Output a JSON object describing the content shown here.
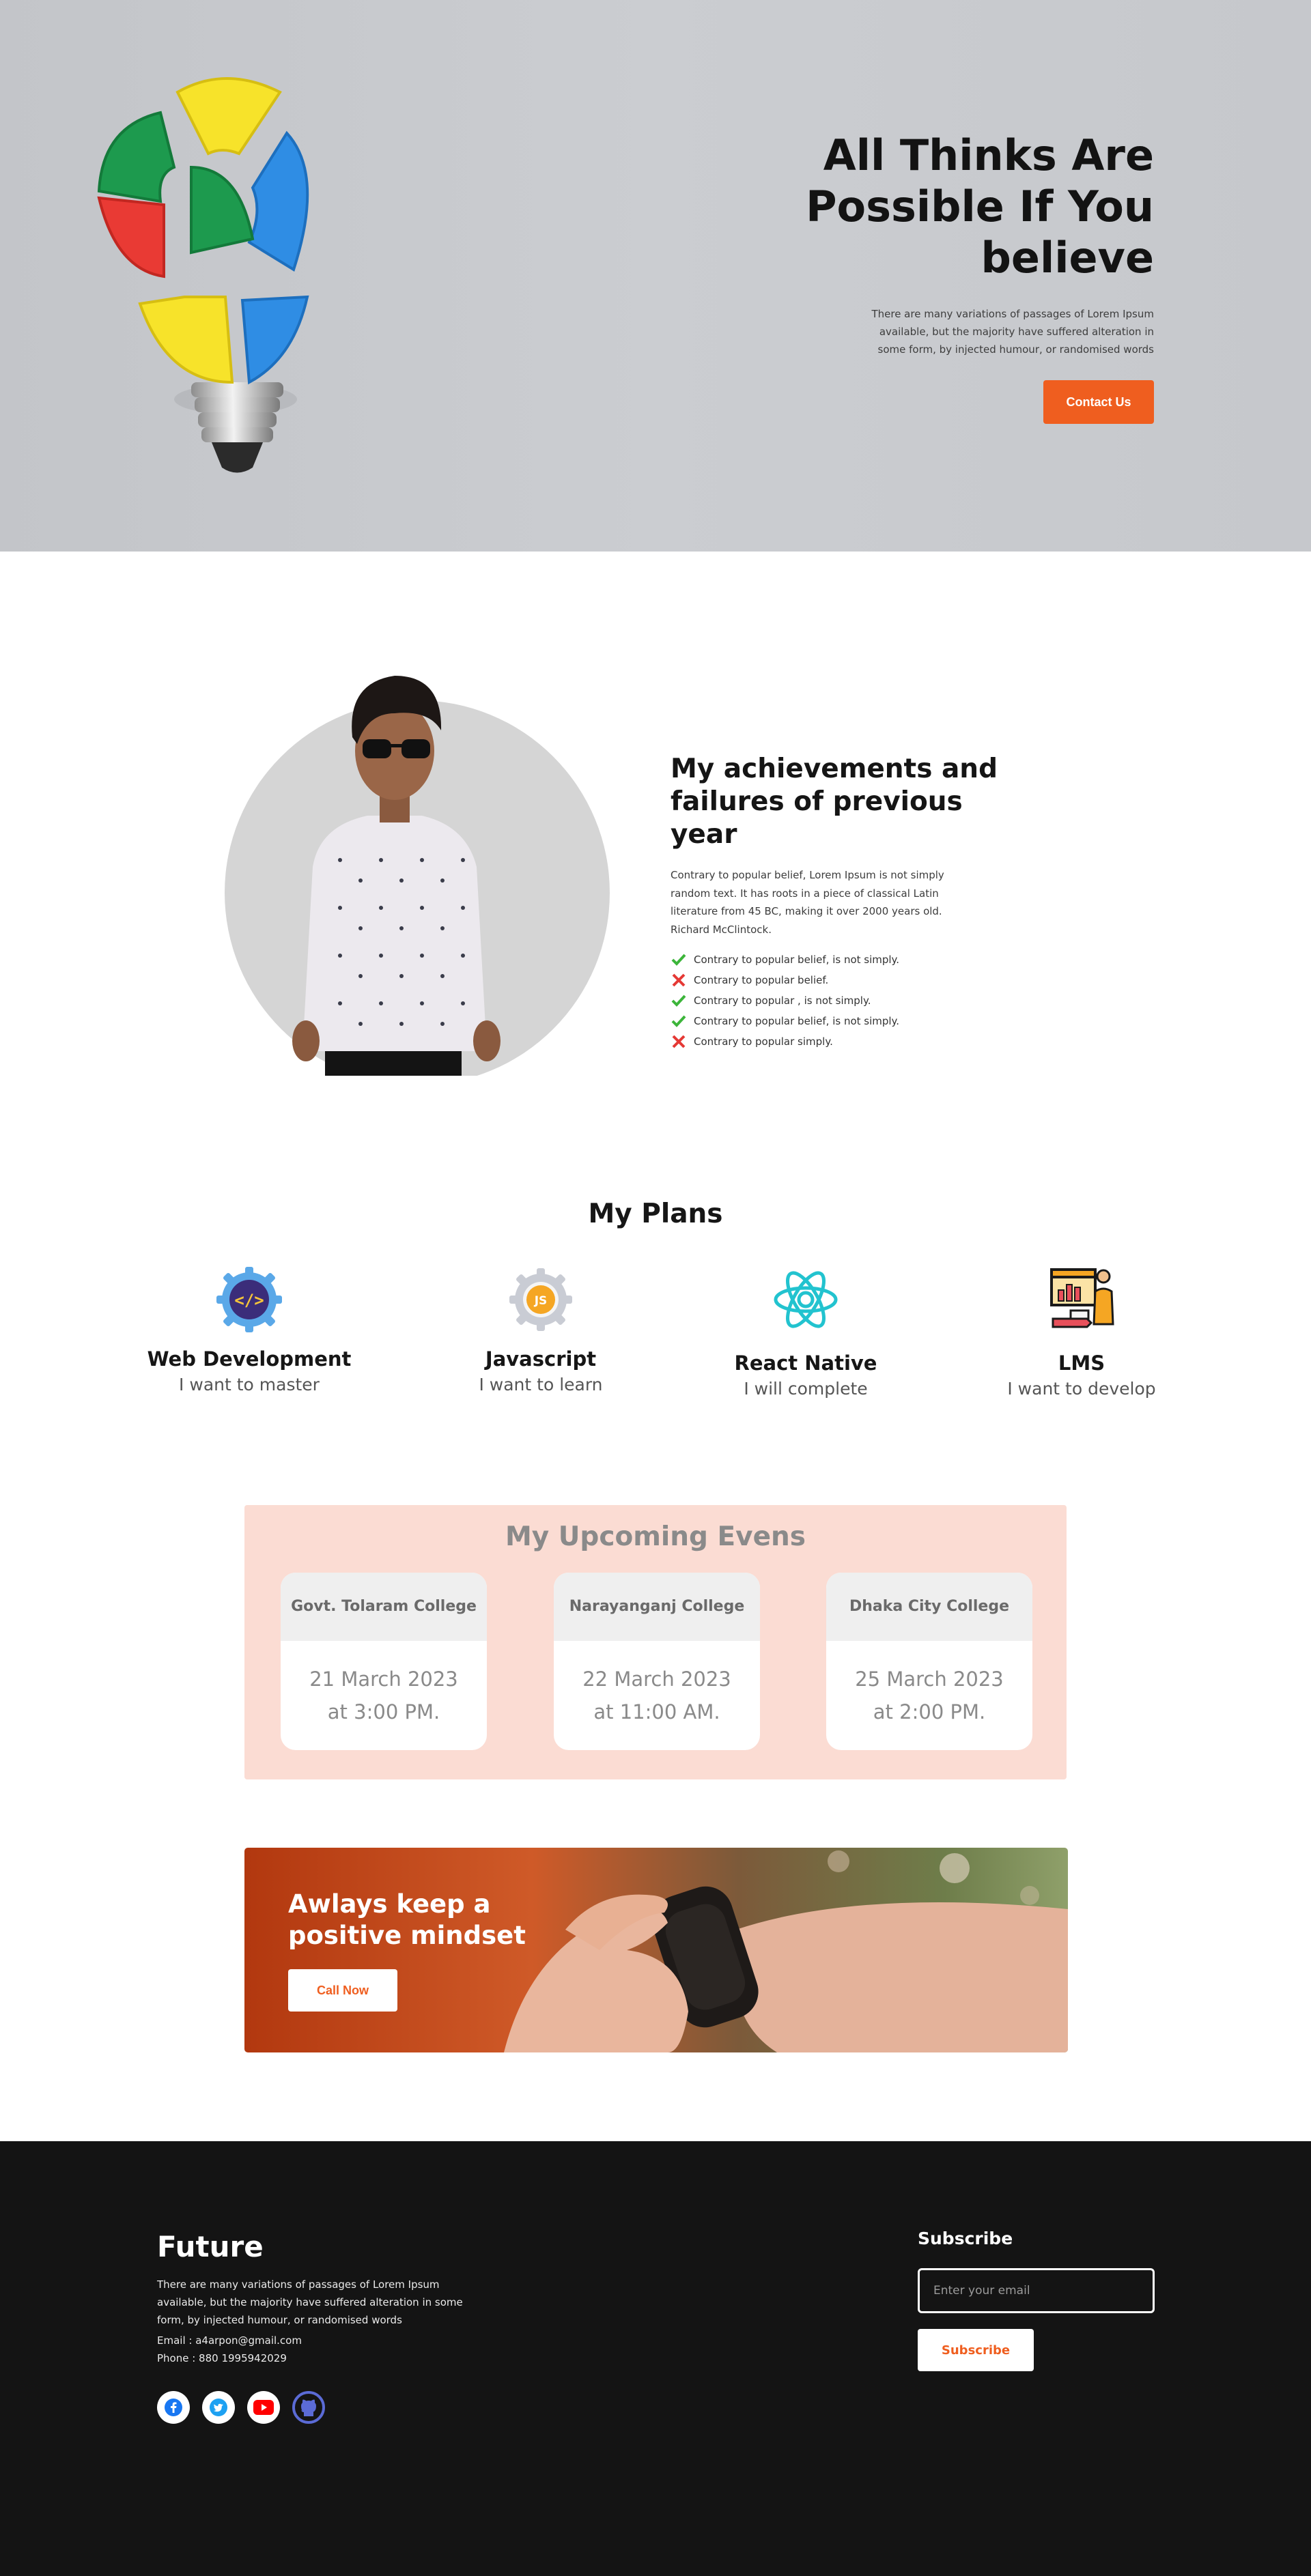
{
  "hero": {
    "title": "All Thinks Are Possible If You believe",
    "subtitle": "There are many variations of passages of Lorem Ipsum available, but the majority have suffered alteration in some form, by injected humour, or randomised words",
    "cta_label": "Contact Us",
    "accent_color": "#ef5e1f"
  },
  "achievements": {
    "title": "My achievements and failures of previous year",
    "description": "Contrary to popular belief, Lorem Ipsum is not simply random text. It has roots in a piece of classical Latin literature from 45 BC, making it over 2000 years old. Richard McClintock.",
    "items": [
      {
        "text": "Contrary to popular belief, is not simply.",
        "status": "check-icon"
      },
      {
        "text": "Contrary to popular belief.",
        "status": "cross-icon"
      },
      {
        "text": "Contrary to popular , is not simply.",
        "status": "check-icon"
      },
      {
        "text": "Contrary to popular belief, is not simply.",
        "status": "check-icon"
      },
      {
        "text": "Contrary to popular simply.",
        "status": "cross-icon"
      }
    ]
  },
  "plans": {
    "title": "My Plans",
    "items": [
      {
        "title": "Web Development",
        "subtitle": "I want to master",
        "icon": "code-gear-icon"
      },
      {
        "title": "Javascript",
        "subtitle": "I want to learn",
        "icon": "js-gear-icon"
      },
      {
        "title": "React Native",
        "subtitle": "I will complete",
        "icon": "atom-icon"
      },
      {
        "title": "LMS",
        "subtitle": "I want to develop",
        "icon": "teacher-board-icon"
      }
    ]
  },
  "events": {
    "title": "My Upcoming Evens",
    "items": [
      {
        "place": "Govt. Tolaram College",
        "date": "21 March 2023",
        "time": "at 3:00 PM."
      },
      {
        "place": "Narayanganj College",
        "date": "22 March 2023",
        "time": "at 11:00 AM."
      },
      {
        "place": "Dhaka City College",
        "date": "25 March 2023",
        "time": "at 2:00 PM."
      }
    ]
  },
  "banner": {
    "title": "Awlays keep a positive mindset",
    "cta_label": "Call Now"
  },
  "footer": {
    "brand": "Future",
    "description": "There are many variations of passages of Lorem Ipsum available, but the majority have suffered alteration in some form, by injected humour, or randomised words",
    "email": "Email : a4arpon@gmail.com",
    "phone": "Phone : 880 1995942029",
    "social": [
      "facebook-icon",
      "twitter-icon",
      "youtube-icon",
      "github-icon"
    ],
    "subscribe_title": "Subscribe",
    "email_placeholder": "Enter your email",
    "subscribe_label": "Subscribe"
  }
}
